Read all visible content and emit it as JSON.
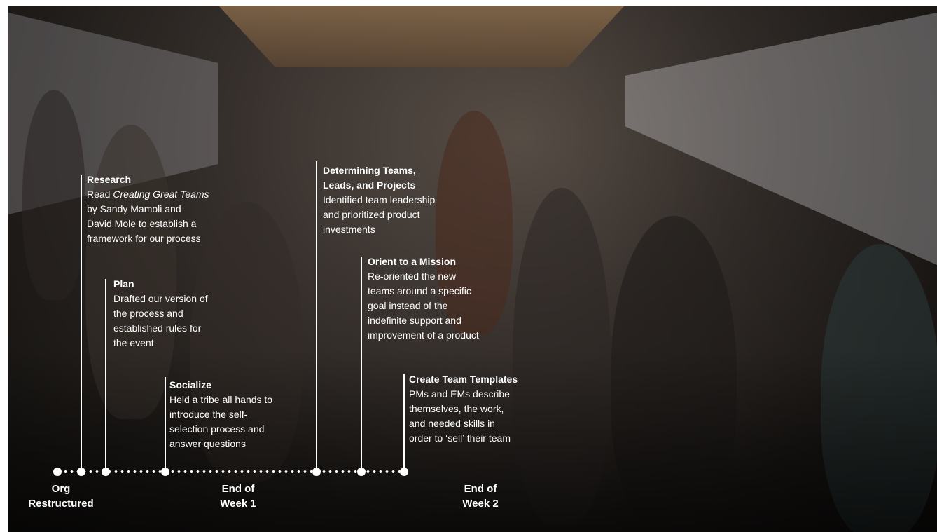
{
  "milestones": [
    {
      "title": "Research",
      "body_before": "Read ",
      "body_em": "Creating Great Teams",
      "body_after": "\nby Sandy Mamoli and\nDavid Mole to establish a\nframework for our process"
    },
    {
      "title": "Plan",
      "body": "Drafted our version of\nthe process and\nestablished rules for\nthe event"
    },
    {
      "title": "Socialize",
      "body": "Held a tribe all hands to\nintroduce the self-\nselection process and\nanswer questions"
    },
    {
      "title": "Determining Teams,\nLeads, and Projects",
      "body": "Identified team leadership\nand prioritized product\ninvestments"
    },
    {
      "title": "Orient to a Mission",
      "body": "Re-oriented the new\nteams around a specific\ngoal instead of the\nindefinite support and\nimprovement of a product"
    },
    {
      "title": "Create Team Templates",
      "body": "PMs and EMs describe\nthemselves, the work,\nand needed skills in\norder to ‘sell’ their team"
    }
  ],
  "timeline_labels": {
    "org_restructured": "Org\nRestructured",
    "end_week_1": "End of\nWeek 1",
    "end_week_2": "End of\nWeek 2"
  },
  "colors": {
    "annotation": "#ffffff",
    "backdrop": "#221e1b"
  }
}
